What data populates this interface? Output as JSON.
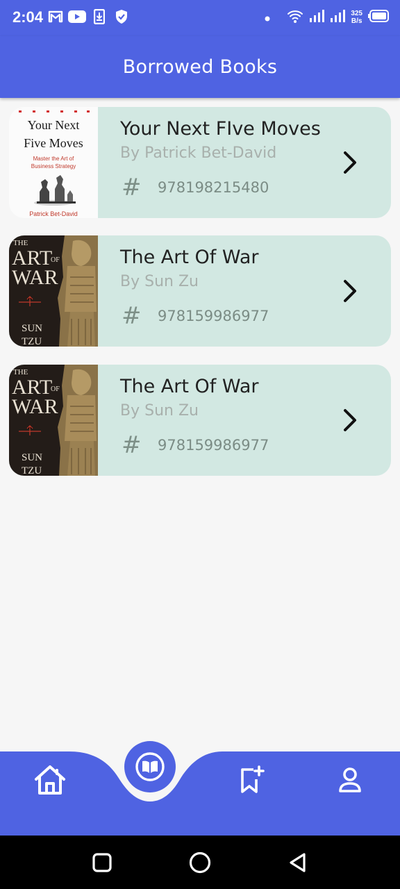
{
  "status_bar": {
    "time": "2:04",
    "net_speed_value": "325",
    "net_speed_unit": "B/s",
    "icons": [
      "gmail-icon",
      "youtube-icon",
      "download-icon",
      "shield-icon",
      "dot-icon",
      "wifi-icon",
      "signal-icon",
      "signal-icon",
      "battery-icon"
    ]
  },
  "app_bar": {
    "title": "Borrowed Books"
  },
  "books": [
    {
      "title": "Your Next FIve Moves",
      "author": "By Patrick Bet-David",
      "isbn": "978198215480",
      "cover": {
        "line1": "Your Next",
        "line2": "Five Moves",
        "subtitle1": "Master the Art of",
        "subtitle2": "Business Strategy",
        "author": "Patrick Bet-David"
      }
    },
    {
      "title": "The Art Of War",
      "author": "By Sun Zu",
      "isbn": "978159986977",
      "cover": {
        "the": "THE",
        "art": "ART",
        "of": "OF",
        "war": "WAR",
        "sun": "SUN",
        "tzu": "TZU"
      }
    },
    {
      "title": "The Art Of War",
      "author": "By Sun Zu",
      "isbn": "978159986977",
      "cover": {
        "the": "THE",
        "art": "ART",
        "of": "OF",
        "war": "WAR",
        "sun": "SUN",
        "tzu": "TZU"
      }
    }
  ],
  "hash_symbol": "#",
  "bottom_nav": {
    "items": [
      "home-icon",
      "book-icon",
      "bookmark-add-icon",
      "user-icon"
    ],
    "active": "book-icon"
  },
  "colors": {
    "primary": "#4f63e2",
    "card": "#d2e8e2",
    "background": "#f6f6f6"
  }
}
